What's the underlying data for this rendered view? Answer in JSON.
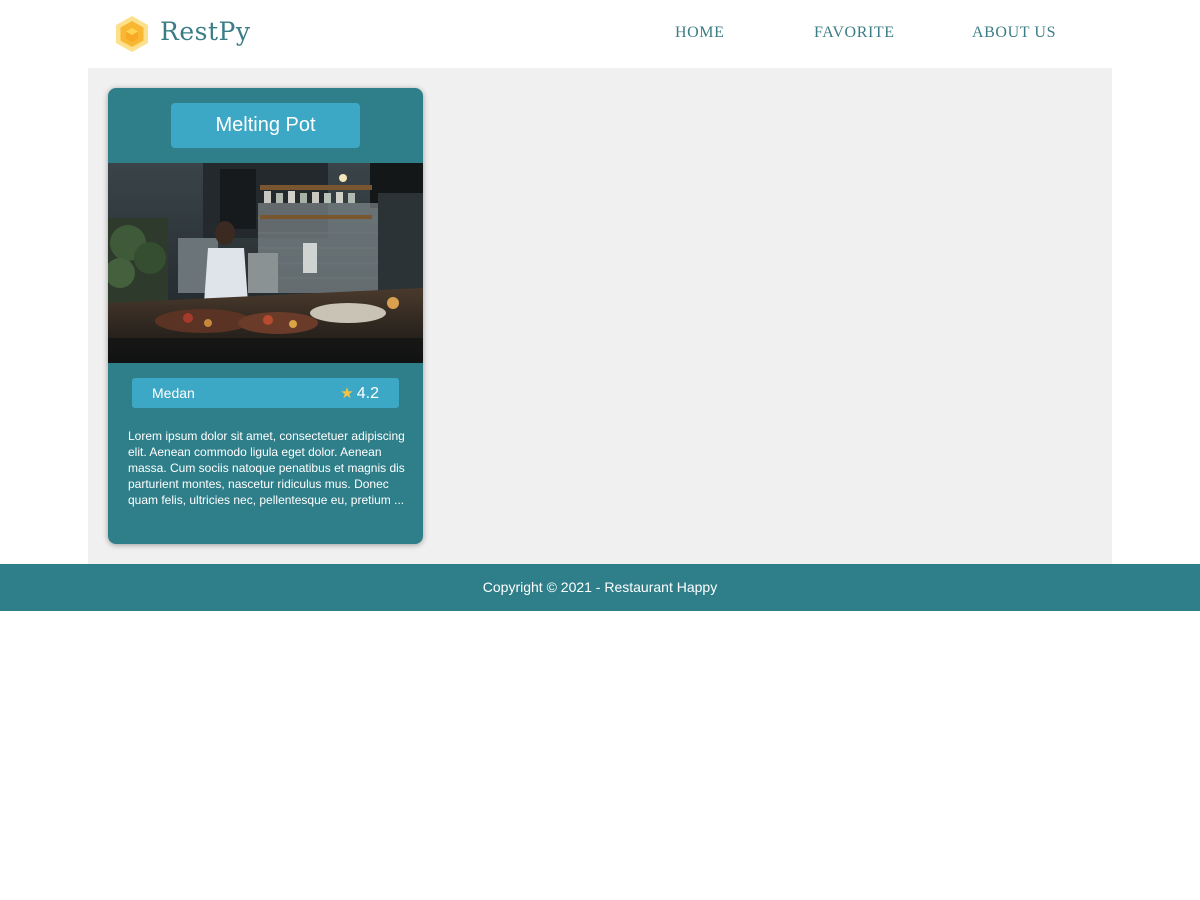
{
  "header": {
    "brand": "RestPy",
    "logo_icon": "hexagon-logo-icon",
    "nav": [
      {
        "label": "HOME"
      },
      {
        "label": "FAVORITE"
      },
      {
        "label": "ABOUT US"
      }
    ]
  },
  "restaurants": [
    {
      "name": "Melting Pot",
      "image": "restaurant-interior-photo",
      "city": "Medan",
      "rating": "4.2",
      "rating_icon": "star-icon",
      "description": "Lorem ipsum dolor sit amet, consectetuer adipiscing elit. Aenean commodo ligula eget dolor. Aenean massa. Cum sociis natoque penatibus et magnis dis parturient montes, nascetur ridiculus mus. Donec quam felis, ultricies nec, pellentesque eu, pretium ..."
    }
  ],
  "footer": {
    "copyright": "Copyright © 2021 - Restaurant Happy"
  },
  "colors": {
    "primary": "#2f7f8a",
    "accent": "#3da8c6",
    "brand_text": "#3b7d86",
    "background": "#f0f0f0",
    "star": "#f6c343"
  }
}
